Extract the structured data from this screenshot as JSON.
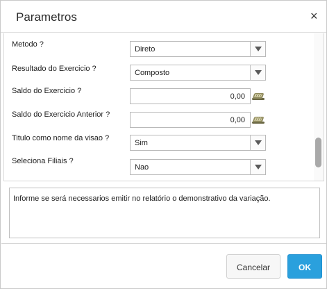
{
  "dialog": {
    "title": "Parametros",
    "close_glyph": "×"
  },
  "form": {
    "fields": [
      {
        "label": "Metodo ?",
        "type": "select",
        "value": "Direto"
      },
      {
        "label": "Resultado do Exercicio ?",
        "type": "select",
        "value": "Composto"
      },
      {
        "label": "Saldo do Exercicio ?",
        "type": "number",
        "value": "0,00",
        "icon": "calculator-icon"
      },
      {
        "label": "Saldo do Exercicio Anterior ?",
        "type": "number",
        "value": "0,00",
        "icon": "calculator-icon"
      },
      {
        "label": "Titulo como nome da visao ?",
        "type": "select",
        "value": "Sim"
      },
      {
        "label": "Seleciona Filiais ?",
        "type": "select",
        "value": "Nao"
      }
    ]
  },
  "help": {
    "text": "Informe se será necessarios emitir no relatório o demonstrativo da variação."
  },
  "footer": {
    "cancel_label": "Cancelar",
    "ok_label": "OK"
  },
  "colors": {
    "primary_button": "#2aa0dd",
    "border": "#b9b9b9"
  }
}
